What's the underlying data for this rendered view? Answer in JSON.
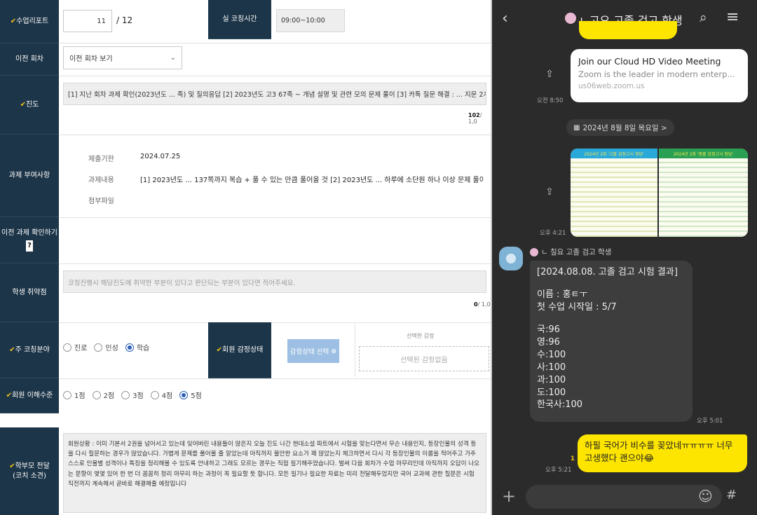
{
  "form": {
    "report": {
      "label": "수업리포트",
      "value": "11",
      "total": "/ 12"
    },
    "actual_time": {
      "label": "실 코칭시간",
      "value": "09:00~10:00"
    },
    "prev_session": {
      "label": "이전 회차",
      "select_value": "이전 회차 보기"
    },
    "progress": {
      "label": "진도",
      "text": "[1] 지난 회차 과제 확인(2023년도 ... 족) 및 질의응답 [2] 2023년도 고3 67족 ~ 개념 설명 및 관련 모의 문제 풀이 [3] 카톡 질문 해결 : ... 지문 2개",
      "count_cur": "102",
      "count_max": "/ 1,0"
    },
    "assignment": {
      "label": "과제 부여사항",
      "deadline_label": "제출기한",
      "deadline_value": "2024.07.25",
      "content_label": "과제내용",
      "content_value": "[1] 2023년도 ... 137쪽까지 복습 + 풀 수 있는 만큼 풀어올 것 [2] 2023년도 ... 하루에 소단원 하나 이상 문제 풀이",
      "attach_label": "첨부파일"
    },
    "prev_assign_check": {
      "label": "이전 과제 확인하기",
      "help": "?"
    },
    "weakness": {
      "label": "학생 취약점",
      "placeholder": "코칭진행시 해당진도에 취약한 부분이 있다고 판단되는 부분이 있다면 적어주세요.",
      "count_cur": "0",
      "count_max": "/ 1,0"
    },
    "coaching_area": {
      "label": "주 코칭분야",
      "options": [
        "진로",
        "인성",
        "학습"
      ],
      "selected": "학습"
    },
    "emotion": {
      "label": "회원 감정상태",
      "button": "감정상태 선택",
      "selected_title": "선택한 감정",
      "selected_empty": "선택된 감정없음"
    },
    "understanding": {
      "label": "회원 이해수준",
      "options": [
        "1점",
        "2점",
        "3점",
        "4점",
        "5점"
      ],
      "selected": "5점"
    },
    "parent_msg": {
      "label_line1": "학부모 전달",
      "label_line2": "(코치 소견)",
      "text": "회원상황 : 이미 기본서 2권을 넘어서고 있는데 잊어버린 내용들이 많은지 오늘 진도 나간 현대소설 파트에서 시험을 맞는다면서 무슨 내용인지, 등장인물의 성격 등을 다시 질문하는 경우가 많았습니다. 가볍게 문제를 풀어볼 줄 알았는데 아직까지 불안한 요소가 꽤 많았는지 체크하면서 다시 각 등장인물의 이름을 적어주고 가주 스스로 인물별 성격이나 특징을 정리해볼 수 있도록 안내하고 그래도 모르는 경우는 직접 필기해주었습니다. 벌써 다음 회차가 수업 마무리인데 아직까지 오답이 나오는 문항이 몇몇 있어 한 번 더 꼼꼼히 정리 마무리 하는 과정이 꼭 필요할 듯 합니다. 모든 필기나 필요한 자료는 미리 전달해두었지만 국어 교과에 관한 질문은 시험 직전까지 계속해서 곧바로 해결해줄 예정입니다"
    }
  },
  "chat": {
    "title": "ㄴ고요 고졸 검고 학생",
    "link": {
      "title": "Join our Cloud HD Video Meeting",
      "desc": "Zoom is the leader in modern enterp...",
      "url": "us06web.zoom.us",
      "time": "오전 8:50"
    },
    "date_divider": "2024년 8월 8일 목요일 >",
    "images": {
      "left_header": "2024년 2회 '고졸 검정고시 정답'",
      "right_header": "2024년 2회 '중졸 검정고시 정답'",
      "time": "오후 4:21"
    },
    "sender": "ㄴ 칠요 고졸 검고 학생",
    "result": {
      "lines": [
        "[2024.08.08. 고졸 검고 시험 결과]",
        "",
        "이름 : 홍ㅌㅜ",
        "첫 수업 시작일 : 5/7",
        "",
        "국:96",
        "영:96",
        "수:100",
        "사:100",
        "과:100",
        "도:100",
        "한국사:100"
      ],
      "time": "오후 5:01"
    },
    "mine": {
      "text": "하필 국어가 비수를 꽂았네ㅠㅠㅠㅠ 너무 고생했다 괜으야😂",
      "time": "오후 5:21",
      "unread": "1"
    },
    "colors": {
      "bg": "#2b2b2b",
      "mine": "#fee500",
      "other": "#3d3d3d",
      "label": "#1d3548",
      "check": "#f0c419"
    }
  }
}
